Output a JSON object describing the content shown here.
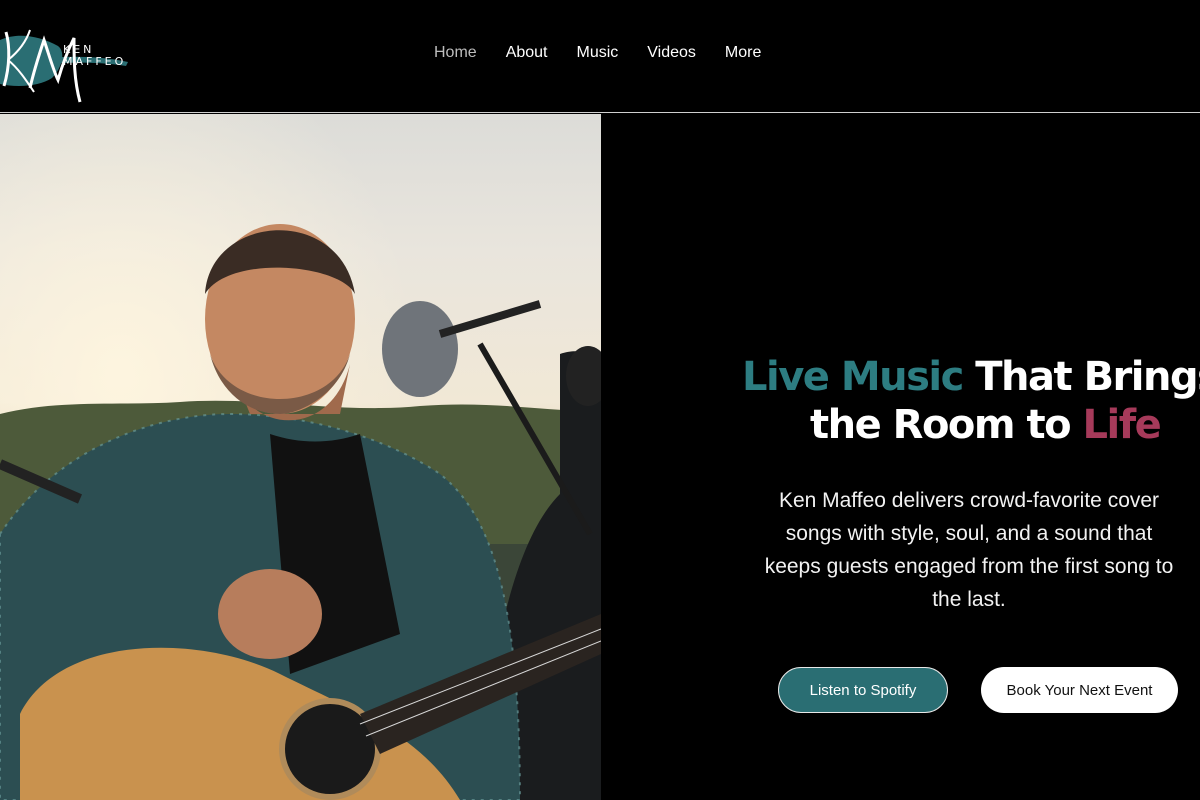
{
  "brand": {
    "monogram": "KM",
    "name_line1": "KEN",
    "name_line2": "MAFFEO"
  },
  "nav": {
    "items": [
      "Home",
      "About",
      "Music",
      "Videos",
      "More"
    ],
    "active": "Home"
  },
  "hero": {
    "headline": {
      "part1_accent": "Live Music",
      "part1_rest": " That Brings",
      "part2_start": "the Room to ",
      "part2_accent": "Life"
    },
    "description": "Ken Maffeo delivers crowd-favorite cover songs with style, soul, and a sound that keeps guests engaged from the first song to the last.",
    "buttons": {
      "primary": "Listen to Spotify",
      "secondary": "Book Your Next Event"
    }
  },
  "colors": {
    "background": "#000000",
    "teal_accent": "#2d7d82",
    "rose_accent": "#a63a5a",
    "button_teal": "#2a6e73",
    "button_white": "#ffffff"
  }
}
